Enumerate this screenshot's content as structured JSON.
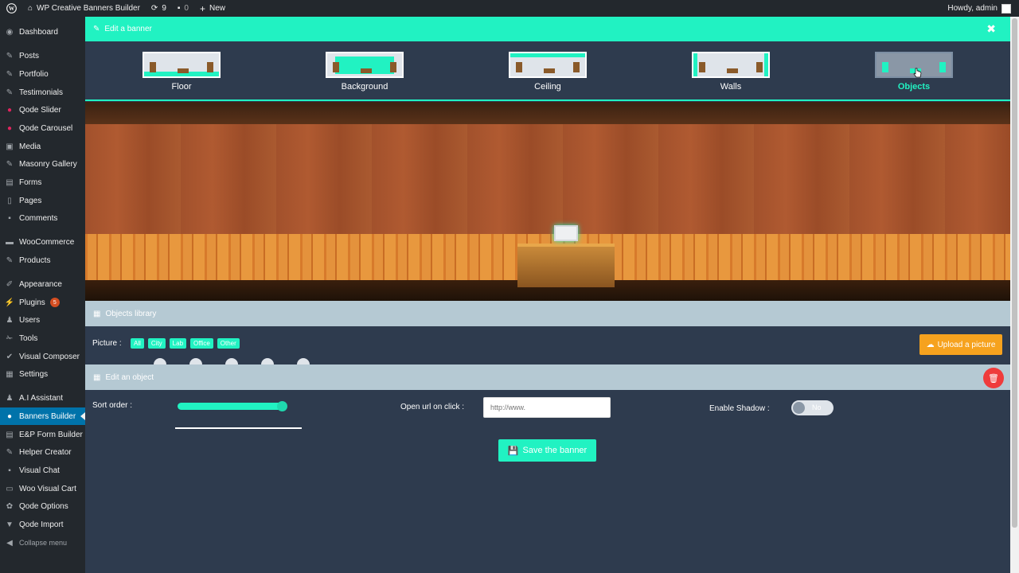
{
  "adminbar": {
    "site_name": "WP Creative Banners Builder",
    "updates_count": "9",
    "comments_count": "0",
    "new_label": "New",
    "howdy": "Howdy, admin"
  },
  "sidebar": {
    "items": [
      {
        "label": "Dashboard",
        "icon": "dashboard-icon"
      },
      {
        "label": "Posts",
        "icon": "pin-icon"
      },
      {
        "label": "Portfolio",
        "icon": "pin-icon"
      },
      {
        "label": "Testimonials",
        "icon": "pin-icon"
      },
      {
        "label": "Qode Slider",
        "icon": "circle-icon"
      },
      {
        "label": "Qode Carousel",
        "icon": "circle-icon"
      },
      {
        "label": "Media",
        "icon": "media-icon"
      },
      {
        "label": "Masonry Gallery",
        "icon": "pin-icon"
      },
      {
        "label": "Forms",
        "icon": "forms-icon"
      },
      {
        "label": "Pages",
        "icon": "page-icon"
      },
      {
        "label": "Comments",
        "icon": "comment-icon"
      },
      {
        "label": "WooCommerce",
        "icon": "woo-icon"
      },
      {
        "label": "Products",
        "icon": "pin-icon"
      },
      {
        "label": "Appearance",
        "icon": "brush-icon"
      },
      {
        "label": "Plugins",
        "icon": "plug-icon",
        "badge": "5"
      },
      {
        "label": "Users",
        "icon": "user-icon"
      },
      {
        "label": "Tools",
        "icon": "wrench-icon"
      },
      {
        "label": "Visual Composer",
        "icon": "vc-icon"
      },
      {
        "label": "Settings",
        "icon": "settings-icon"
      },
      {
        "label": "A.I Assistant",
        "icon": "user-icon"
      },
      {
        "label": "Banners Builder",
        "icon": "circle-icon"
      },
      {
        "label": "E&P Form Builder",
        "icon": "forms-icon"
      },
      {
        "label": "Helper Creator",
        "icon": "pin-icon"
      },
      {
        "label": "Visual Chat",
        "icon": "comment-icon"
      },
      {
        "label": "Woo Visual Cart",
        "icon": "cart-icon"
      },
      {
        "label": "Qode Options",
        "icon": "gear-icon"
      },
      {
        "label": "Qode Import",
        "icon": "import-icon"
      }
    ],
    "collapse_label": "Collapse menu"
  },
  "editor": {
    "title": "Edit a banner",
    "tabs": [
      {
        "label": "Floor"
      },
      {
        "label": "Background"
      },
      {
        "label": "Ceiling"
      },
      {
        "label": "Walls"
      },
      {
        "label": "Objects"
      }
    ],
    "active_tab": "Objects"
  },
  "library": {
    "title": "Objects library",
    "picture_label": "Picture :",
    "filters": [
      "All",
      "City",
      "Lab",
      "Office",
      "Other"
    ],
    "upload_label": "Upload a picture"
  },
  "object_editor": {
    "title": "Edit an object",
    "sort_order_label": "Sort order :",
    "sort_order_fraction": 0.95,
    "open_url_label": "Open url on click :",
    "url_placeholder": "http://www.",
    "shadow_label": "Enable Shadow :",
    "shadow_value": "No",
    "save_label": "Save the banner"
  },
  "colors": {
    "accent": "#21f2c2",
    "panel": "#2e3b4e",
    "section_bar": "#b5c9d3",
    "upload": "#f6a21e",
    "danger": "#ef3b3b"
  }
}
